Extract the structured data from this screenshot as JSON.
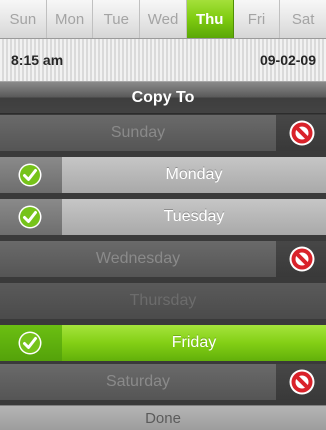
{
  "tabs": [
    {
      "label": "Sun",
      "active": false
    },
    {
      "label": "Mon",
      "active": false
    },
    {
      "label": "Tue",
      "active": false
    },
    {
      "label": "Wed",
      "active": false
    },
    {
      "label": "Thu",
      "active": true
    },
    {
      "label": "Fri",
      "active": false
    },
    {
      "label": "Sat",
      "active": false
    }
  ],
  "status": {
    "time": "8:15 am",
    "date": "09-02-09"
  },
  "header": {
    "title": "Copy To"
  },
  "days": [
    {
      "label": "Sunday",
      "state": "disabled",
      "icon": "ban-icon"
    },
    {
      "label": "Monday",
      "state": "checked",
      "icon": "check-icon"
    },
    {
      "label": "Tuesday",
      "state": "checked",
      "icon": "check-icon"
    },
    {
      "label": "Wednesday",
      "state": "disabled",
      "icon": "ban-icon"
    },
    {
      "label": "Thursday",
      "state": "current",
      "icon": ""
    },
    {
      "label": "Friday",
      "state": "selected",
      "icon": "check-icon"
    },
    {
      "label": "Saturday",
      "state": "disabled",
      "icon": "ban-icon"
    }
  ],
  "footer": {
    "done_label": "Done"
  },
  "colors": {
    "accent_green": "#7ecb10",
    "ban_red": "#d9222a"
  }
}
